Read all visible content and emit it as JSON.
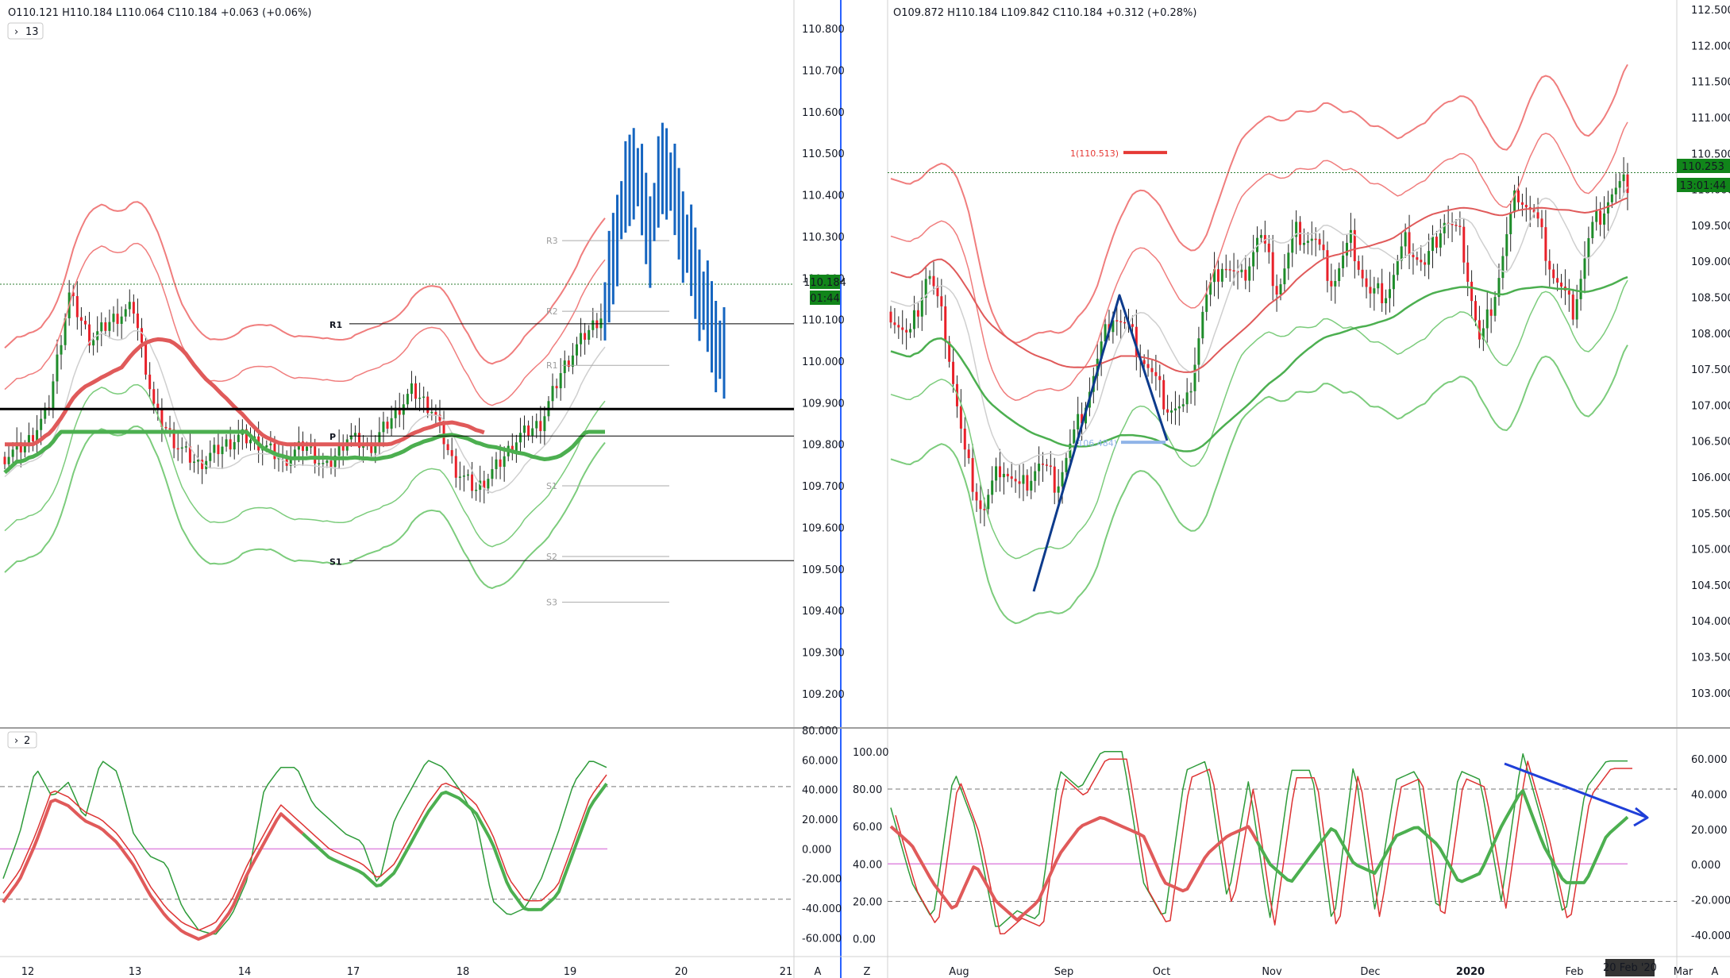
{
  "colors": {
    "bull": "#1e8c2a",
    "bear": "#e8212a",
    "blue": "#1565c0",
    "navy": "#0d3b8c",
    "band_red": "#f07d7d",
    "band_green": "#7ccc7c",
    "ma_red": "#e05a5a",
    "ma_green": "#4caf50",
    "gray_ma": "#cfcfcf",
    "border_blue": "#2962ff",
    "price_tag": "#11851a",
    "pink_line": "#e08ae0",
    "grid": "#e6e6e6"
  },
  "left_panel": {
    "ohlc": "O110.121 H110.184 L110.064 C110.184 +0.063 (+0.06%)",
    "collapse_label": "13",
    "oscillator_label": "2",
    "price_label": "110.184",
    "countdown": "01:44",
    "pivots": {
      "r1": "R1",
      "s1": "S1",
      "p": "P",
      "r3": "R3",
      "r2": "R2",
      "r1_proj": "R1",
      "s1_proj": "S1",
      "s2": "S2",
      "s3": "S3"
    },
    "x_labels": [
      "12",
      "13",
      "14",
      "17",
      "18",
      "19",
      "20",
      "21"
    ],
    "corner_label": "A"
  },
  "right_panel": {
    "ohlc": "O109.872 H110.184 L109.842 C110.184 +0.312 (+0.28%)",
    "target_label": "1(110.513)",
    "pattern_label": "(106.484)",
    "price_label": "110.253",
    "countdown": "13:01:44",
    "x_labels": [
      "Aug",
      "Sep",
      "Oct",
      "Nov",
      "Dec",
      "2020",
      "Feb",
      "Mar"
    ],
    "date_tag": "20 Feb '20",
    "corner_z": "Z",
    "corner_a": "A"
  },
  "chart_data": [
    {
      "type": "candlestick",
      "title": "",
      "timeframe_axis": [
        "12",
        "13",
        "14",
        "17",
        "18",
        "19",
        "20",
        "21"
      ],
      "ylim": [
        109.15,
        110.85
      ],
      "y_ticks": [
        "110.800",
        "110.700",
        "110.600",
        "110.500",
        "110.400",
        "110.300",
        "110.200",
        "110.100",
        "110.000",
        "109.900",
        "109.800",
        "109.700",
        "109.600",
        "109.500",
        "109.400",
        "109.300",
        "109.200"
      ],
      "last_price": 110.184,
      "support_resistance": {
        "R1": 110.09,
        "S1": 109.52,
        "P": 109.82,
        "black_line": 109.885
      },
      "projected_pivots": {
        "R3": 110.29,
        "R2": 110.12,
        "R1": 109.99,
        "S1": 109.7,
        "S2": 109.53,
        "S3": 109.42
      },
      "candle_path": [
        109.77,
        109.8,
        109.88,
        110.16,
        110.05,
        110.1,
        110.13,
        109.88,
        109.8,
        109.75,
        109.79,
        109.82,
        109.8,
        109.76,
        109.8,
        109.74,
        109.82,
        109.79,
        109.86,
        109.93,
        109.88,
        109.74,
        109.69,
        109.75,
        109.82,
        109.85,
        109.98,
        110.06,
        110.12
      ],
      "projection_path": [
        110.12,
        110.35,
        110.48,
        110.3,
        110.49,
        110.35,
        110.22,
        110.1,
        110.0
      ]
    },
    {
      "type": "oscillator",
      "ylim": [
        -70,
        80
      ],
      "y_ticks": [
        "80.000",
        "60.000",
        "40.000",
        "20.000",
        "0.000",
        "-20.000",
        "-40.000",
        "-60.000"
      ],
      "dashed_levels": [
        42,
        -34
      ],
      "zero_line": 0,
      "series": [
        {
          "values": [
            -20,
            10,
            55,
            35,
            45,
            20,
            60,
            52,
            10,
            -5,
            -10,
            -40,
            -55,
            -58,
            -45,
            -20,
            40,
            55,
            55,
            30,
            20,
            10,
            5,
            -25,
            20,
            40,
            60,
            55,
            40,
            20,
            -35,
            -45,
            -40,
            -20,
            10,
            45,
            60,
            55
          ]
        },
        {
          "values": [
            -30,
            -15,
            10,
            40,
            35,
            25,
            20,
            10,
            -5,
            -25,
            -40,
            -50,
            -55,
            -50,
            -35,
            -10,
            10,
            30,
            20,
            10,
            0,
            -5,
            -10,
            -20,
            -10,
            10,
            30,
            45,
            40,
            30,
            10,
            -20,
            -35,
            -35,
            -25,
            5,
            35,
            50
          ]
        }
      ]
    },
    {
      "type": "candlestick",
      "title": "",
      "x_axis": [
        "Aug",
        "Sep",
        "Oct",
        "Nov",
        "Dec",
        "2020",
        "Feb",
        "Mar"
      ],
      "ylim": [
        102.7,
        112.6
      ],
      "y_ticks": [
        "112.500",
        "112.000",
        "111.500",
        "111.000",
        "110.500",
        "110.000",
        "109.500",
        "109.000",
        "108.500",
        "108.000",
        "107.500",
        "107.000",
        "106.500",
        "106.000",
        "105.500",
        "105.000",
        "104.500",
        "104.000",
        "103.500",
        "103.000"
      ],
      "last_price": 110.253,
      "target_level": 110.513,
      "pattern_level": 106.484,
      "candle_path": [
        108.3,
        107.9,
        108.9,
        108.0,
        106.3,
        105.5,
        106.2,
        105.8,
        106.2,
        105.9,
        106.6,
        107.4,
        108.3,
        108.0,
        107.5,
        107.0,
        106.9,
        108.4,
        109.0,
        108.7,
        109.4,
        108.6,
        109.4,
        109.3,
        108.7,
        109.3,
        108.5,
        108.6,
        109.3,
        108.9,
        109.6,
        109.3,
        107.8,
        108.8,
        110.0,
        109.6,
        108.8,
        108.3,
        109.4,
        109.9,
        110.1
      ]
    },
    {
      "type": "oscillator",
      "ylim": [
        -1,
        105
      ],
      "y_ticks_left": [
        "100.00",
        "80.00",
        "60.00",
        "40.00",
        "20.00",
        "0.00"
      ],
      "y_ticks_right": [
        "60.000",
        "40.000",
        "20.000",
        "0.000",
        "-20.000",
        "-40.000"
      ],
      "dashed_levels": [
        80,
        20
      ],
      "zero_line": 40,
      "series": [
        {
          "values": [
            70,
            30,
            10,
            90,
            60,
            5,
            15,
            10,
            90,
            80,
            100,
            100,
            30,
            10,
            90,
            95,
            20,
            85,
            10,
            90,
            90,
            5,
            95,
            15,
            85,
            90,
            10,
            90,
            85,
            20,
            100,
            60,
            10,
            80,
            95,
            95
          ]
        },
        {
          "values": [
            60,
            50,
            30,
            15,
            40,
            20,
            10,
            20,
            45,
            60,
            65,
            60,
            55,
            30,
            25,
            45,
            55,
            60,
            40,
            30,
            45,
            60,
            40,
            35,
            55,
            60,
            50,
            30,
            35,
            60,
            80,
            50,
            30,
            30,
            55,
            65
          ]
        }
      ]
    }
  ]
}
